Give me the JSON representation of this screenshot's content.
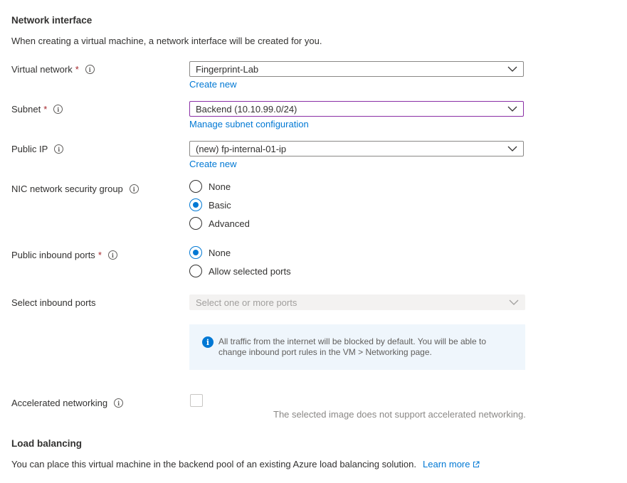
{
  "network_interface": {
    "heading": "Network interface",
    "description": "When creating a virtual machine, a network interface will be created for you.",
    "virtual_network": {
      "label": "Virtual network",
      "required_mark": "*",
      "value": "Fingerprint-Lab",
      "link": "Create new"
    },
    "subnet": {
      "label": "Subnet",
      "required_mark": "*",
      "value": "Backend (10.10.99.0/24)",
      "link": "Manage subnet configuration"
    },
    "public_ip": {
      "label": "Public IP",
      "value": "(new) fp-internal-01-ip",
      "link": "Create new"
    },
    "nic_nsg": {
      "label": "NIC network security group",
      "options": [
        "None",
        "Basic",
        "Advanced"
      ],
      "selected": "Basic"
    },
    "public_inbound_ports": {
      "label": "Public inbound ports",
      "required_mark": "*",
      "options": [
        "None",
        "Allow selected ports"
      ],
      "selected": "None"
    },
    "select_inbound_ports": {
      "label": "Select inbound ports",
      "placeholder": "Select one or more ports"
    },
    "info_message": "All traffic from the internet will be blocked by default. You will be able to change inbound port rules in the VM > Networking page.",
    "accelerated_networking": {
      "label": "Accelerated networking",
      "checked": false,
      "note": "The selected image does not support accelerated networking."
    }
  },
  "load_balancing": {
    "heading": "Load balancing",
    "description": "You can place this virtual machine in the backend pool of an existing Azure load balancing solution.",
    "link": "Learn more"
  },
  "icons": {
    "info": "info-icon",
    "chevron": "chevron-down-icon",
    "external": "external-link-icon"
  },
  "colors": {
    "accent": "#0078d4",
    "required": "#a4262c",
    "focus_border": "#8a2fa5",
    "info_background": "#eff6fc"
  }
}
